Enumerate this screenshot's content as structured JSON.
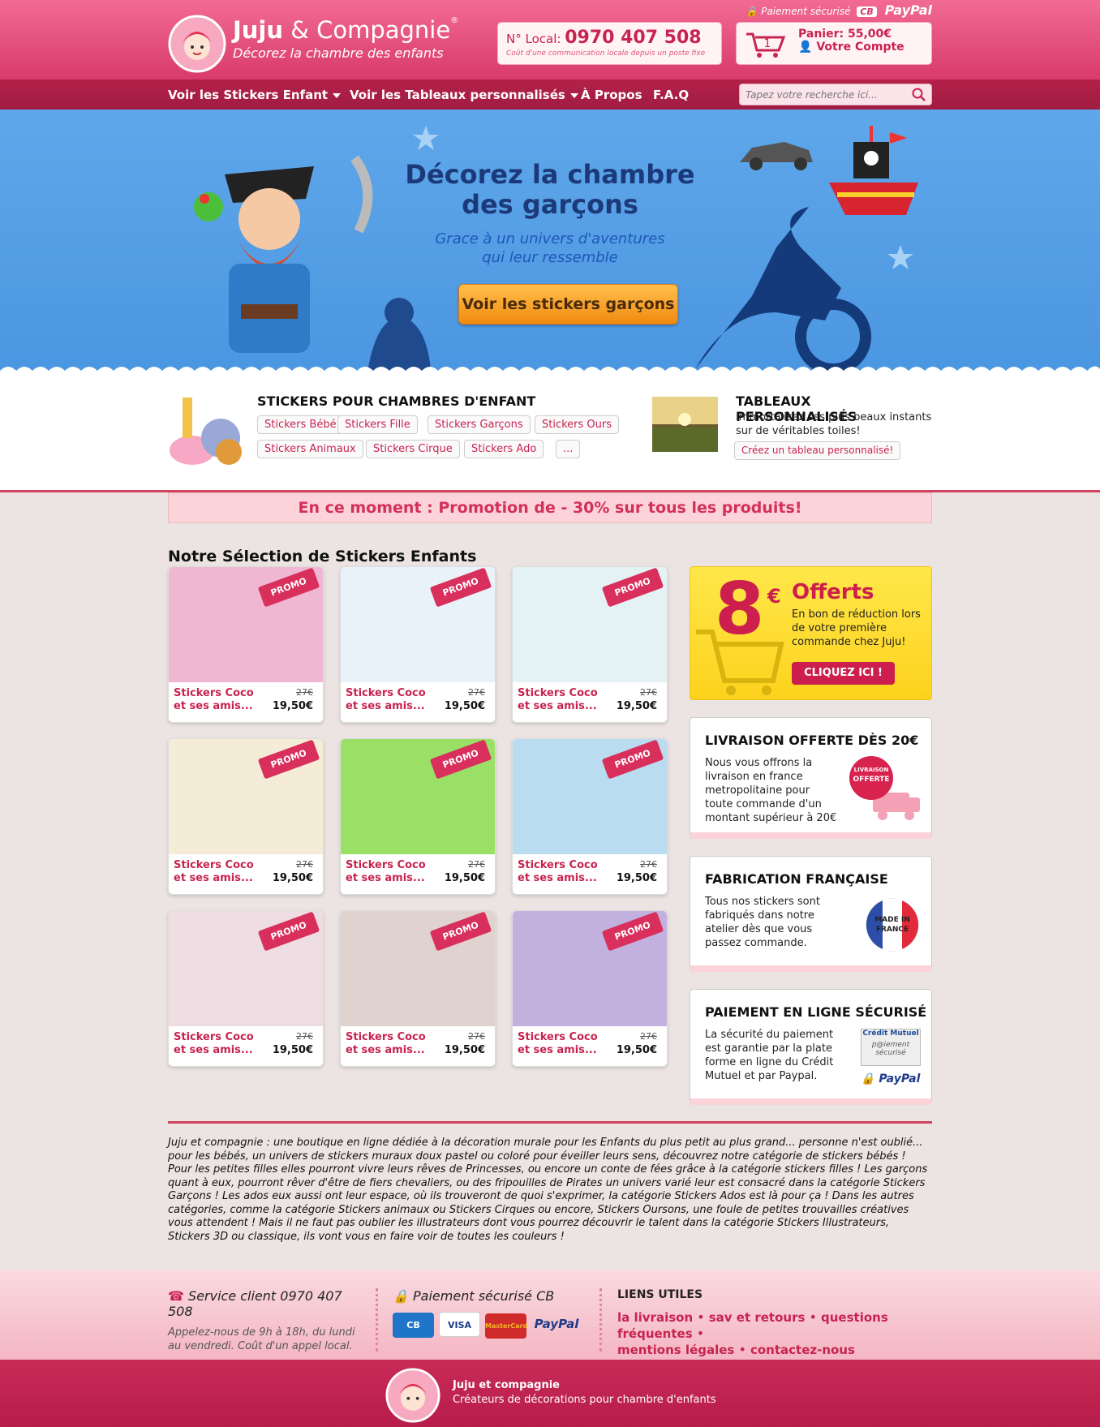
{
  "header": {
    "brand_name": "Juju",
    "brand_amp": " & Compagnie",
    "brand_tagline": "Décorez la chambre des enfants",
    "secure_label": "Paiement sécurisé",
    "secure_cb": "CB",
    "secure_paypal": "PayPal",
    "phone_prefix": "N° Local:",
    "phone_number": "0970 407 508",
    "phone_note": "Coût d'une communication locale depuis un poste fixe",
    "cart_count": "1",
    "cart_total": "Panier: 55,00€",
    "account_label": "Votre Compte"
  },
  "nav": {
    "items": [
      "Voir les Stickers Enfant",
      "Voir les Tableaux personnalisés",
      "À Propos",
      "F.A.Q"
    ],
    "search_placeholder": "Tapez votre recherche ici..."
  },
  "hero": {
    "title_line1": "Décorez la chambre",
    "title_line2": "des garçons",
    "subtitle_line1": "Grace à un univers d'aventures",
    "subtitle_line2": "qui leur ressemble",
    "cta": "Voir les stickers garçons"
  },
  "categories": {
    "stickers_title": "STICKERS POUR CHAMBRES D'ENFANT",
    "chips": [
      "Stickers Bébé",
      "Stickers Fille",
      "Stickers Garçons",
      "Stickers Ours",
      "Stickers Animaux",
      "Stickers Cirque",
      "Stickers Ado",
      "..."
    ],
    "tableaux_title": "TABLEAUX PERSONNALISÉS",
    "tableaux_desc_line1": "Immortalisez ses plus beaux instants",
    "tableaux_desc_line2": "sur de véritables toiles!",
    "tableaux_cta": "Créez un tableau personnalisé!"
  },
  "promo_banner": "En ce moment : Promotion de - 30% sur tous les produits!",
  "selection": {
    "title": "Notre Sélection de Stickers Enfants",
    "products": [
      {
        "name": "Stickers Coco et ses amis...",
        "old_price": "27€",
        "price": "19,50€",
        "badge": "PROMO",
        "bg": "#f0b7d2"
      },
      {
        "name": "Stickers Coco et ses amis...",
        "old_price": "27€",
        "price": "19,50€",
        "badge": "PROMO",
        "bg": "#e9f2f8"
      },
      {
        "name": "Stickers Coco et ses amis...",
        "old_price": "27€",
        "price": "19,50€",
        "badge": "PROMO",
        "bg": "#e5f2f3"
      },
      {
        "name": "Stickers Coco et ses amis...",
        "old_price": "27€",
        "price": "19,50€",
        "badge": "PROMO",
        "bg": "#f5ecd8"
      },
      {
        "name": "Stickers Coco et ses amis...",
        "old_price": "27€",
        "price": "19,50€",
        "badge": "PROMO",
        "bg": "#9be066"
      },
      {
        "name": "Stickers Coco et ses amis...",
        "old_price": "27€",
        "price": "19,50€",
        "badge": "PROMO",
        "bg": "#b9dcf0"
      },
      {
        "name": "Stickers Coco et ses amis...",
        "old_price": "27€",
        "price": "19,50€",
        "badge": "PROMO",
        "bg": "#eedde3"
      },
      {
        "name": "Stickers Coco et ses amis...",
        "old_price": "27€",
        "price": "19,50€",
        "badge": "PROMO",
        "bg": "#dfd2cf"
      },
      {
        "name": "Stickers Coco et ses amis...",
        "old_price": "27€",
        "price": "19,50€",
        "badge": "PROMO",
        "bg": "#c2b1df"
      }
    ]
  },
  "sidebar": {
    "offer_amount": "8",
    "offer_currency": "€",
    "offer_title": "Offerts",
    "offer_text": "En bon de réduction lors de votre première commande chez Juju!",
    "offer_cta": "CLIQUEZ ICI !",
    "delivery_title": "LIVRAISON OFFERTE DÈS 20€",
    "delivery_text": "Nous vous offrons la livraison en france metropolitaine pour toute commande d'un montant supérieur à 20€",
    "delivery_badge_top": "LIVRAISON",
    "delivery_badge_mid": "OFFERTE",
    "made_title": "FABRICATION FRANÇAISE",
    "made_text": "Tous nos stickers sont fabriqués dans notre atelier dès que vous passez commande.",
    "made_badge_1": "MADE IN",
    "made_badge_2": "FRANCE",
    "payment_title": "PAIEMENT EN LIGNE SÉCURISÉ",
    "payment_text": "La sécurité du paiement est garantie par la plate forme en ligne du Crédit Mutuel et par Paypal.",
    "payment_badge_bank": "Crédit Mutuel",
    "payment_badge_label": "p@iement sécurisé",
    "payment_badge_paypal": "PayPal"
  },
  "about_text": "Juju et compagnie : une boutique en ligne dédiée à la décoration murale pour les Enfants du plus petit au  plus grand... personne n'est oublié... pour les bébés, un univers de stickers muraux doux pastel ou coloré pour éveiller leurs sens, découvrez notre catégorie de stickers bébés ! Pour les petites filles elles pourront vivre leurs rêves de Princesses, ou encore un conte de fées grâce à la catégorie stickers filles ! Les garçons quant à eux, pourront rêver d'être de fiers chevaliers, ou des fripouilles de Pirates un univers varié leur est consacré dans la catégorie Stickers Garçons ! Les ados eux aussi ont leur espace, où ils trouveront de quoi s'exprimer, la catégorie Stickers Ados est là pour ça ! Dans les autres catégories, comme la catégorie Stickers animaux ou Stickers Cirques ou encore, Stickers Oursons, une foule de petites trouvailles créatives vous attendent ! Mais il ne faut pas oublier les illustrateurs dont vous pourrez découvrir le talent dans la catégorie Stickers Illustrateurs, Stickers 3D ou classique, ils vont vous en faire voir de toutes les couleurs !",
  "footer": {
    "service_title": "Service client 0970 407 508",
    "service_hours": "Appelez-nous de 9h à 18h, du lundi au vendredi. Coût d'un appel local.",
    "payment_title": "Paiement sécurisé CB",
    "cards": [
      "CB",
      "VISA",
      "MasterCard",
      "PayPal"
    ],
    "links_title": "LIENS UTILES",
    "links": [
      "la livraison",
      "sav et retours",
      "questions fréquentes",
      "mentions légales",
      "contactez-nous"
    ],
    "bottom_name": "Juju et compagnie",
    "bottom_tagline": "Créateurs de décorations pour chambre d'enfants"
  },
  "colors": {
    "brand": "#d83a6c",
    "nav": "#a81e45",
    "hero": "#4f9be3",
    "accent_orange": "#f5a020",
    "offer_yellow": "#fddc2a"
  },
  "icons": [
    "lock-icon",
    "cart-icon",
    "user-icon",
    "search-icon",
    "phone-icon",
    "star-icon"
  ]
}
